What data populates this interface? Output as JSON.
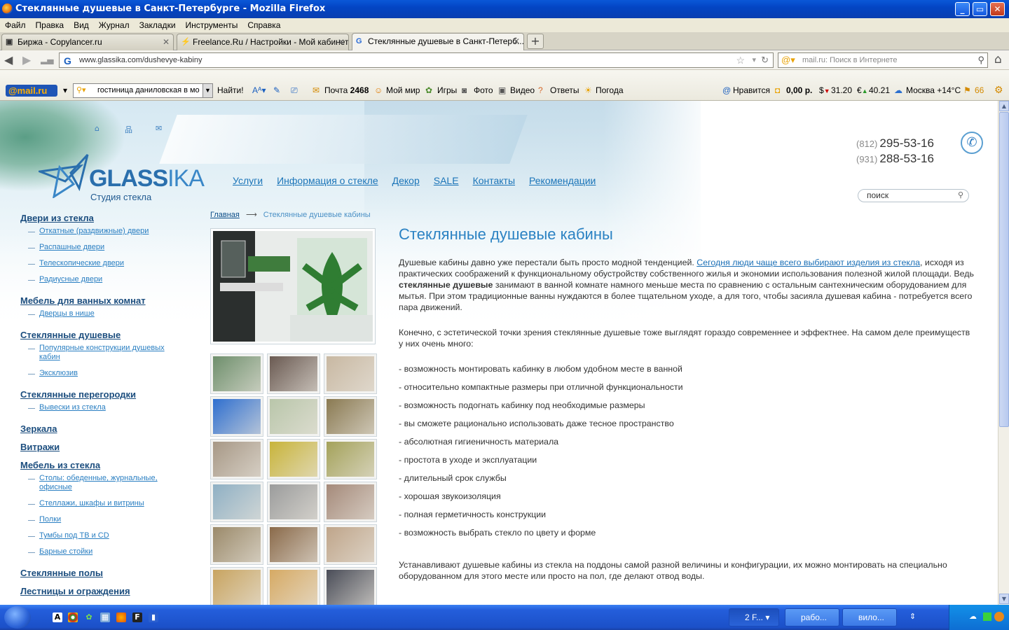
{
  "window": {
    "title": "Стеклянные душевые в Санкт-Петербурге - Mozilla Firefox"
  },
  "menu": [
    "Файл",
    "Правка",
    "Вид",
    "Журнал",
    "Закладки",
    "Инструменты",
    "Справка"
  ],
  "tabs": [
    {
      "label": "Биржа - Copylancer.ru",
      "active": false
    },
    {
      "label": "Freelance.Ru / Настройки - Мой кабинет",
      "active": false
    },
    {
      "label": "Стеклянные душевые в Санкт-Петерб...",
      "active": true
    }
  ],
  "nav": {
    "url": "www.glassika.com/dushevye-kabiny",
    "search_placeholder": "mail.ru: Поиск в Интернете"
  },
  "mailbar": {
    "logo": "@mail.ru",
    "search_value": "гостиница даниловская в мо",
    "find": "Найти!",
    "mail_label": "Почта",
    "mail_count": "2468",
    "myworld": "Мой мир",
    "games": "Игры",
    "photo": "Фото",
    "video": "Видео",
    "answers": "Ответы",
    "weather": "Погода",
    "like": "Нравится",
    "balance": "0,00 р.",
    "usd": "31.20",
    "eur": "40.21",
    "city": "Москва +14°C",
    "traffic": "66"
  },
  "site": {
    "logo_name_1": "GLASS",
    "logo_name_2": "IKA",
    "logo_sub": "Студия стекла",
    "topnav": [
      "Услуги",
      "Информация о стекле",
      "Декор",
      "SALE",
      "Контакты",
      "Рекомендации"
    ],
    "phones": [
      {
        "code": "(812)",
        "number": "295-53-16"
      },
      {
        "code": "(931)",
        "number": "288-53-16"
      }
    ],
    "search_placeholder": "поиск",
    "breadcrumb_home": "Главная",
    "breadcrumb_arrow": "⟶",
    "breadcrumb_current": "Стеклянные душевые кабины"
  },
  "sidebar": [
    {
      "title": "Двери из стекла",
      "items": [
        "Откатные (раздвижные) двери",
        "Распашные двери",
        "Телескопические двери",
        "Радиусные двери"
      ]
    },
    {
      "title": "Мебель для ванных комнат",
      "items": [
        "Дверцы в нише"
      ]
    },
    {
      "title": "Стеклянные душевые",
      "items": [
        "Популярные конструкции душевых кабин",
        "Эксклюзив"
      ]
    },
    {
      "title": "Стеклянные перегородки",
      "items": [
        "Вывески из стекла"
      ]
    },
    {
      "title": "Зеркала",
      "items": []
    },
    {
      "title": "Витражи",
      "items": []
    },
    {
      "title": "Мебель из стекла",
      "items": [
        "Столы: обеденные, журнальные, офисные",
        "Стеллажи, шкафы и витрины",
        "Полки",
        "Тумбы под ТВ и CD",
        "Барные стойки"
      ]
    },
    {
      "title": "Стеклянные полы",
      "items": []
    },
    {
      "title": "Лестницы и ограждения",
      "items": []
    }
  ],
  "content": {
    "title": "Стеклянные душевые кабины",
    "p1_a": "Душевые кабины давно уже перестали быть просто модной тенденцией. ",
    "p1_link": "Сегодня люди чаще всего выбирают изделия из стекла",
    "p1_b": ", исходя из практических соображений к функциональному обустройству собственного жилья и экономии использования полезной жилой площади. Ведь ",
    "p1_bold": "стеклянные душевые",
    "p1_c": " занимают в ванной комнате намного меньше места по сравнению с остальным сантехническим оборудованием для мытья. При этом традиционные ванны нуждаются в более тщательном уходе, а для того, чтобы засияла душевая кабина - потребуется всего пара движений.",
    "p2": "Конечно, с эстетической точки зрения стеклянные душевые тоже выглядят гораздо современнее и эффектнее. На самом деле преимуществ у них очень много:",
    "list": [
      "- возможность монтировать кабинку в любом удобном месте в ванной",
      "- относительно компактные размеры при отличной функциональности",
      "- возможность подогнать кабинку под необходимые размеры",
      "- вы сможете рационально использовать даже тесное пространство",
      "- абсолютная гигиеничность материала",
      "- простота в уходе и эксплуатации",
      "- длительный срок службы",
      "- хорошая звукоизоляция",
      "- полная герметичность конструкции",
      "- возможность выбрать стекло по цвету и форме"
    ],
    "p3": "Устанавливают душевые кабины из стекла на поддоны самой разной величины и конфигурации, их можно монтировать на специально оборудованном для этого месте или просто на пол, где делают отвод воды."
  },
  "thumb_colors": [
    "#6e8f6c",
    "#6a5a52",
    "#c8b8a2",
    "#2f6fcf",
    "#b9c6aa",
    "#8a7a52",
    "#a79886",
    "#c8b43a",
    "#a4a25a",
    "#8fb0c4",
    "#9b9c9c",
    "#a58a7a",
    "#9b8a6a",
    "#8a6a4a",
    "#bfa58a",
    "#c8a460",
    "#d6aa64",
    "#4a4d58"
  ],
  "taskbar": {
    "buttons": [
      "2 F...",
      "рабо...",
      "вило..."
    ]
  }
}
